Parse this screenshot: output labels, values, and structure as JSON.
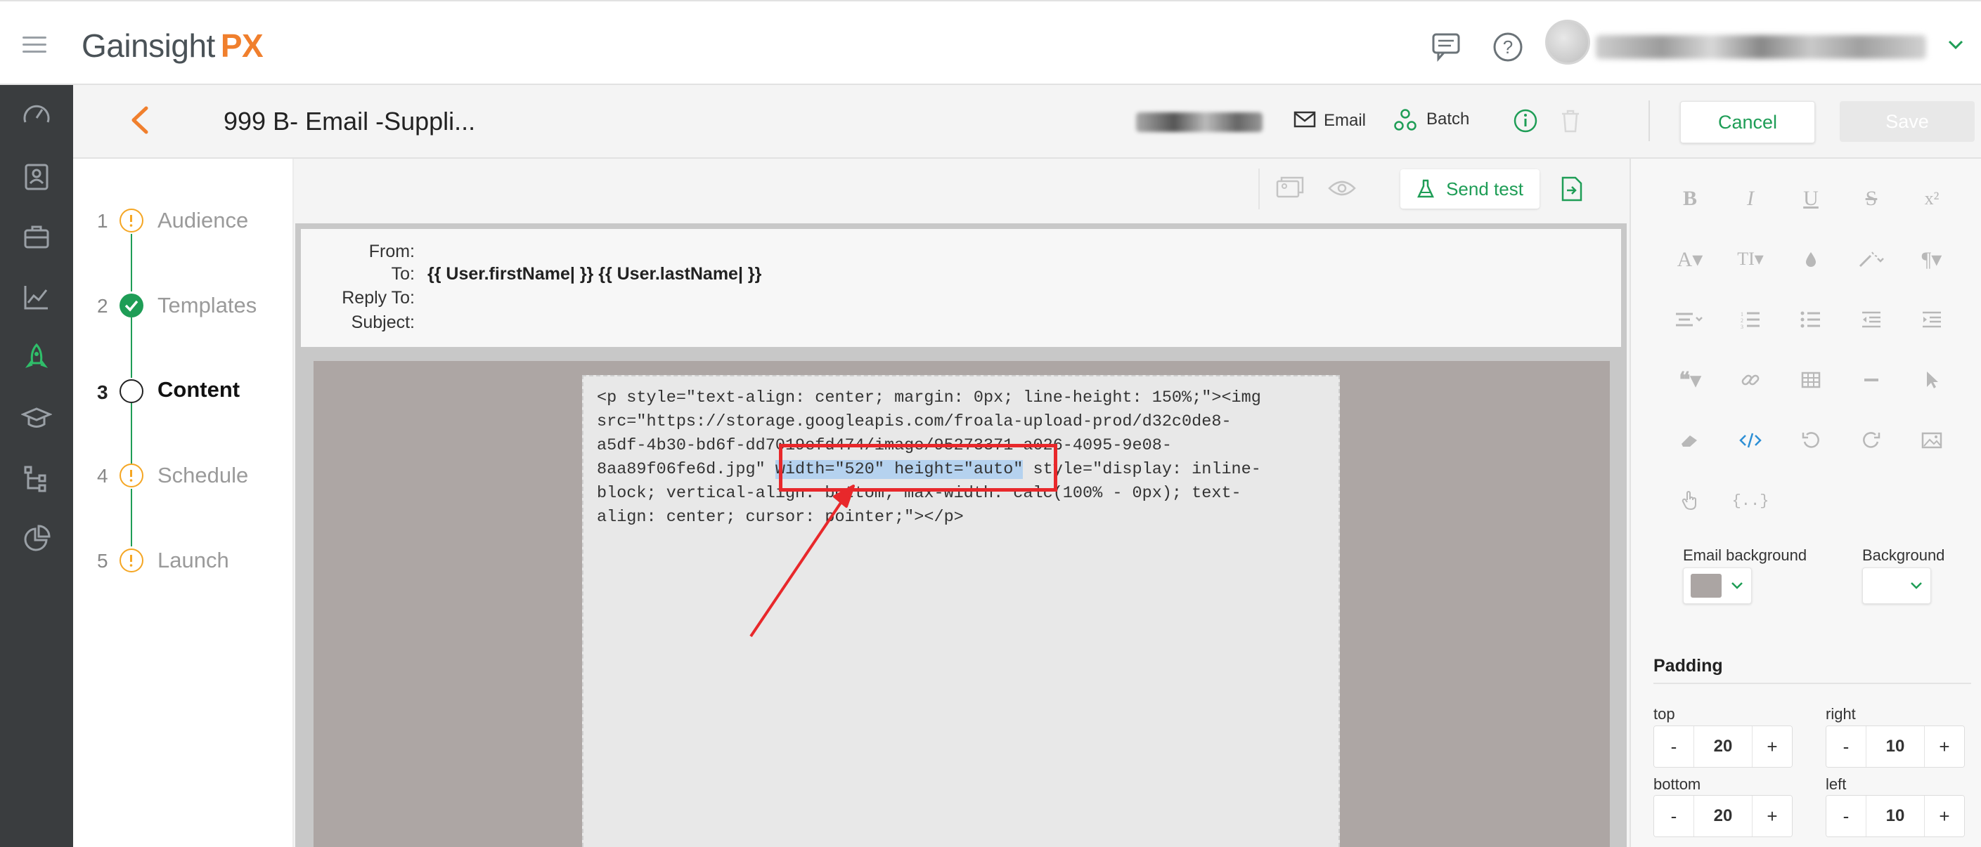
{
  "app": {
    "brand_main": "Gainsight",
    "brand_accent": "PX"
  },
  "header": {
    "title": "999 B- Email -Suppli...",
    "channel_label": "Email",
    "batch_label": "Batch",
    "cancel_label": "Cancel",
    "save_label": "Save"
  },
  "steps": [
    {
      "num": "1",
      "label": "Audience",
      "status": "warning"
    },
    {
      "num": "2",
      "label": "Templates",
      "status": "done"
    },
    {
      "num": "3",
      "label": "Content",
      "status": "current"
    },
    {
      "num": "4",
      "label": "Schedule",
      "status": "warning"
    },
    {
      "num": "5",
      "label": "Launch",
      "status": "warning"
    }
  ],
  "toolbar": {
    "send_test_label": "Send test"
  },
  "email_headers": {
    "from_label": "From:",
    "to_label": "To:",
    "to_value": "{{ User.firstName| }} {{ User.lastName| }}",
    "reply_to_label": "Reply To:",
    "subject_label": "Subject:"
  },
  "code": {
    "line1": "<p style=\"text-align: center; margin: 0px; line-height: 150%;\"><img",
    "line2": "src=\"https://storage.googleapis.com/froala-upload-prod/d32c0de8-",
    "line3": "a5df-4b30-bd6f-dd7019efd474/image/95273371-a026-4095-9e08-",
    "line4_pre": "8aa89f06fe6d.jpg\" ",
    "line4_highlight": "width=\"520\" height=\"auto\"",
    "line4_post": " style=\"display: inline-",
    "line5": "block; vertical-align: bottom; max-width: calc(100% - 0px); text-",
    "line6": "align: center; cursor: pointer;\"></p>"
  },
  "right_panel": {
    "email_background_label": "Email background",
    "background_label": "Background",
    "email_background_color": "#aba5a3",
    "padding_title": "Padding",
    "top_label": "top",
    "top_value": "20",
    "right_label": "right",
    "right_value": "10",
    "bottom_label": "bottom",
    "bottom_value": "20",
    "left_label": "left",
    "left_value": "10",
    "minus": "-",
    "plus": "+"
  },
  "colors": {
    "accent": "#1e9d56",
    "brand_orange": "#f07f2d",
    "warning": "#f5a623",
    "annotation_red": "#e8282b"
  }
}
